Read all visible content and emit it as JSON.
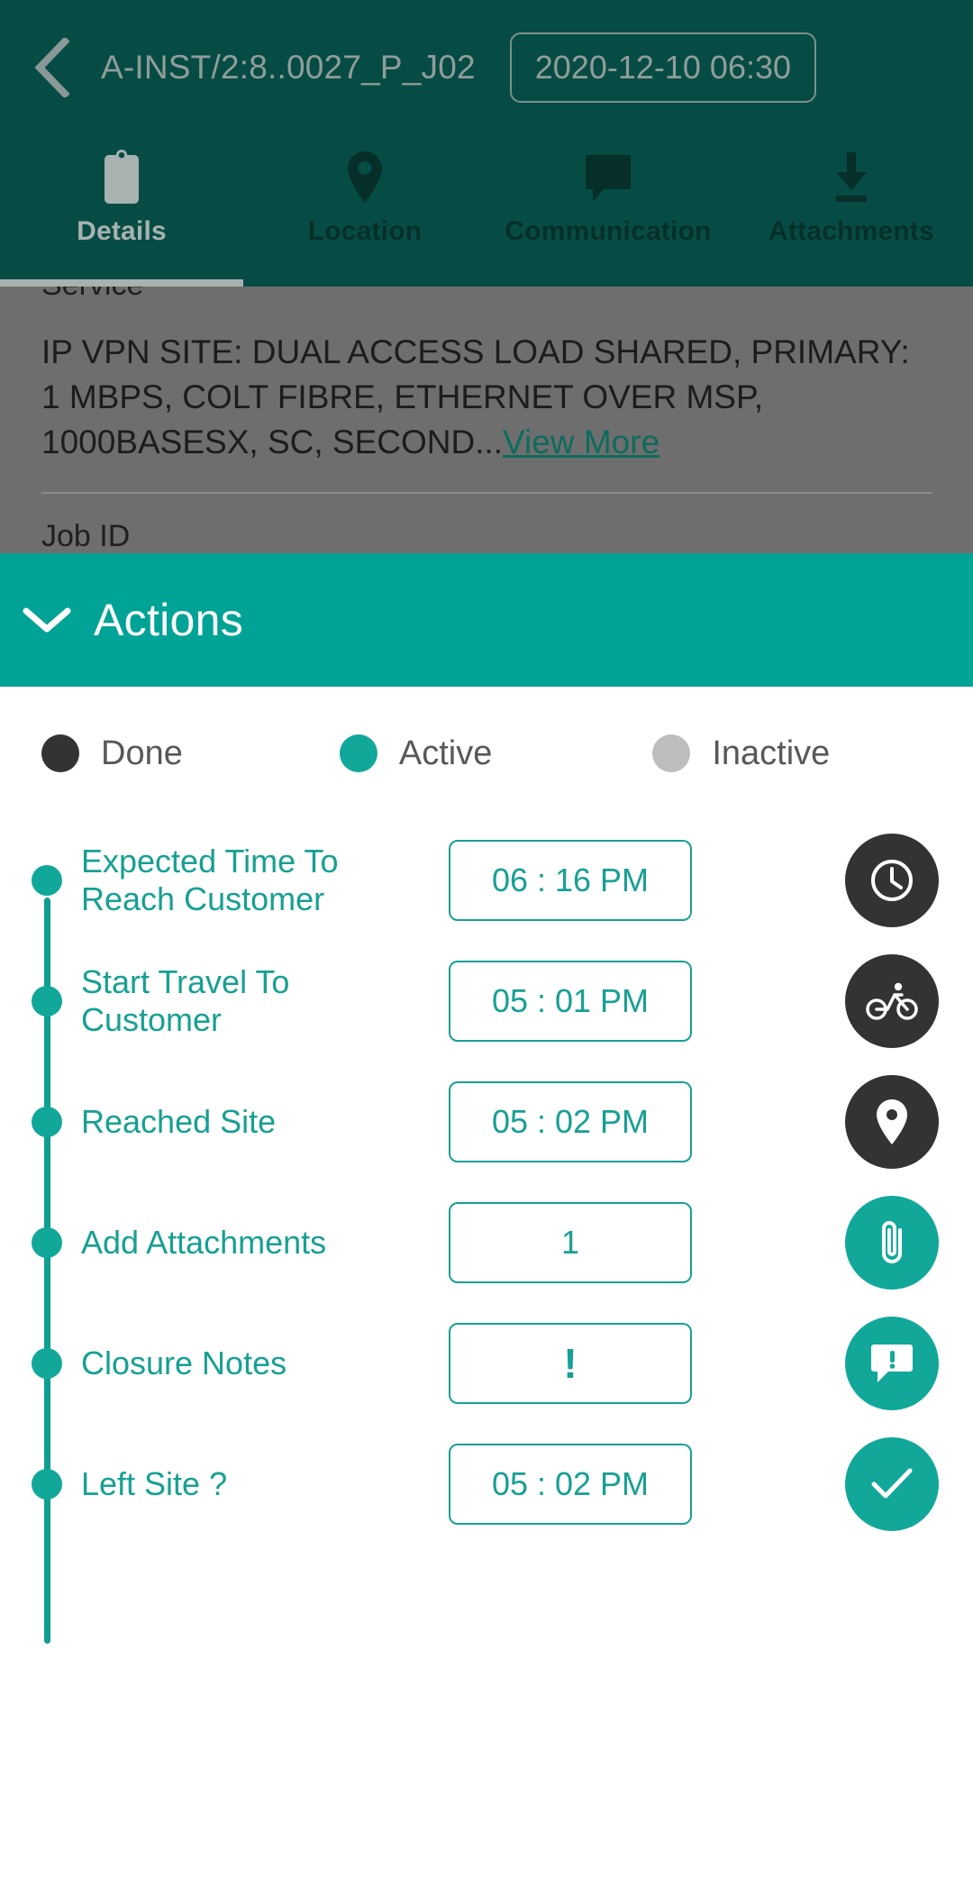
{
  "header": {
    "back_icon": "chevron-left-icon",
    "title": "A-INST/2:8..0027_P_J02",
    "date_pill": "2020-12-10 06:30"
  },
  "tabs": [
    {
      "label": "Details",
      "icon": "clipboard-icon",
      "active": true
    },
    {
      "label": "Location",
      "icon": "map-pin-icon",
      "active": false
    },
    {
      "label": "Communication",
      "icon": "comment-icon",
      "active": false
    },
    {
      "label": "Attachments",
      "icon": "download-icon",
      "active": false
    }
  ],
  "detail": {
    "service_label": "Service",
    "description": "IP VPN SITE: DUAL ACCESS LOAD SHARED, PRIMARY: 1 MBPS, COLT FIBRE, ETHERNET OVER MSP, 1000BASESX, SC, SECOND...",
    "view_more": "View More",
    "job_id_label": "Job ID"
  },
  "actions": {
    "title": "Actions",
    "chevron_icon": "chevron-down-icon"
  },
  "legend": [
    {
      "label": "Done",
      "color": "#333333"
    },
    {
      "label": "Active",
      "color": "#11a89a"
    },
    {
      "label": "Inactive",
      "color": "#bdbdbd"
    }
  ],
  "colors": {
    "header_bg": "#064c44",
    "actions_bg": "#00a396",
    "teal": "#17a093",
    "done": "#333333",
    "inactive": "#bdbdbd",
    "scrim": "#6e6e6e"
  },
  "rows": [
    {
      "label": "Expected Time To Reach Customer",
      "value": "06 : 16 PM",
      "icon": "clock-icon",
      "btn_state": "done",
      "dot_state": "active"
    },
    {
      "label": "Start Travel To Customer",
      "value": "05 : 01 PM",
      "icon": "bicycle-icon",
      "btn_state": "done",
      "dot_state": "active"
    },
    {
      "label": "Reached Site",
      "value": "05 : 02 PM",
      "icon": "map-pin-icon",
      "btn_state": "done",
      "dot_state": "active"
    },
    {
      "label": "Add Attachments",
      "value": "1",
      "icon": "paperclip-icon",
      "btn_state": "active",
      "dot_state": "active"
    },
    {
      "label": "Closure Notes",
      "value": "!",
      "icon": "comment-alert-icon",
      "btn_state": "active",
      "dot_state": "active"
    },
    {
      "label": "Left Site ?",
      "value": "05 : 02 PM",
      "icon": "check-icon",
      "btn_state": "active",
      "dot_state": "active"
    }
  ]
}
